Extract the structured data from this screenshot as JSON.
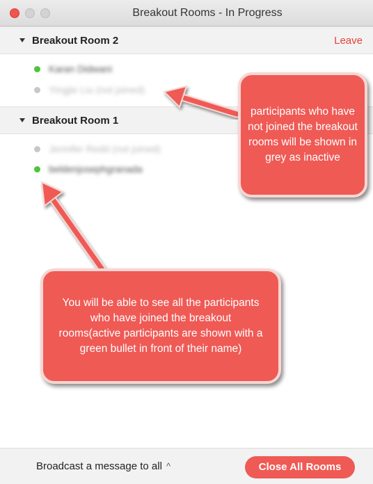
{
  "window": {
    "title": "Breakout Rooms - In Progress"
  },
  "rooms": [
    {
      "name": "Breakout Room 2",
      "leave_label": "Leave",
      "participants": [
        {
          "name": "Karan Didwani",
          "status": "active"
        },
        {
          "name": "Yingjie Liu (not joined)",
          "status": "inactive"
        }
      ]
    },
    {
      "name": "Breakout Room 1",
      "participants": [
        {
          "name": "Jennifer Redd (not joined)",
          "status": "inactive"
        },
        {
          "name": "beldenjosephgranada",
          "status": "active"
        }
      ]
    }
  ],
  "annotations": {
    "inactive_note": "participants who have not joined the breakout rooms will be shown in grey as inactive",
    "active_note": "You will be able to see all the participants who have joined the breakout rooms(active participants are shown with a green bullet in front of their name)"
  },
  "footer": {
    "broadcast_label": "Broadcast a message to all",
    "broadcast_icon": "^",
    "close_all_label": "Close All Rooms"
  },
  "colors": {
    "accent": "#ef5a55",
    "leave": "#e5413d",
    "active_dot": "#4cc53b",
    "inactive_dot": "#c8c8c8"
  }
}
